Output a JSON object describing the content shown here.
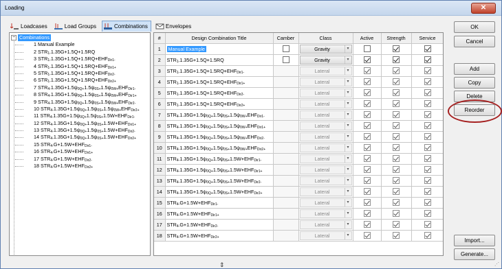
{
  "window": {
    "title": "Loading",
    "close_glyph": "✕"
  },
  "tabs": [
    {
      "label": "Loadcases",
      "icon": "loadcases-icon"
    },
    {
      "label": "Load Groups",
      "icon": "load-groups-icon"
    },
    {
      "label": "Combinations",
      "icon": "combinations-icon",
      "active": true
    },
    {
      "label": "Envelopes",
      "icon": "envelopes-icon"
    }
  ],
  "tree": {
    "root_label": "Combinations",
    "items": [
      "1 Manual Example",
      "2 STR_1-1.35G+1.5Q+1.5RQ",
      "3 STR_1-1.35G+1.5Q+1.5RQ+EHF_Dir1-",
      "4 STR_1-1.35G+1.5Q+1.5RQ+EHF_Dir1+",
      "5 STR_1-1.35G+1.5Q+1.5RQ+EHF_Dir2-",
      "6 STR_1-1.35G+1.5Q+1.5RQ+EHF_Dir2+",
      "7 STR_4-1.35G+1.5ψ_0Q+1.5ψ_0S+1.5ψ_0W+EHF_Dir1-",
      "8 STR_4-1.35G+1.5ψ_0Q+1.5ψ_0S+1.5ψ_0W+EHF_Dir1+",
      "9 STR_4-1.35G+1.5ψ_0Q+1.5ψ_0S+1.5ψ_0W+EHF_Dir2-",
      "10 STR_4-1.35G+1.5ψ_0Q+1.5ψ_0S+1.5ψ_0W+EHF_Dir2+",
      "11 STR_4-1.35G+1.5ψ_0Q+1.5ψ_0S+1.5W+EHF_Dir1-",
      "12 STR_4-1.35G+1.5ψ_0Q+1.5ψ_0S+1.5W+EHF_Dir1+",
      "13 STR_4-1.35G+1.5ψ_0Q+1.5ψ_0S+1.5W+EHF_Dir2-",
      "14 STR_4-1.35G+1.5ψ_0Q+1.5ψ_0S+1.5W+EHF_Dir2+",
      "15 STR_4-G+1.5W+EHF_Dir1-",
      "16 STR_4-G+1.5W+EHF_Dir1+",
      "17 STR_4-G+1.5W+EHF_Dir2-",
      "18 STR_4-G+1.5W+EHF_Dir2+"
    ]
  },
  "table": {
    "headers": [
      "#",
      "Design Combination Title",
      "Camber",
      "Class",
      "Active",
      "Strength",
      "Service"
    ],
    "rows": [
      {
        "n": "1",
        "title": "Manual Example",
        "camber": "unchecked",
        "cls": "Gravity",
        "cls_enabled": true,
        "active": false,
        "strength": true,
        "service": true,
        "selected": true
      },
      {
        "n": "2",
        "title": "STR_1-1.35G+1.5Q+1.5RQ",
        "camber": "unchecked",
        "cls": "Gravity",
        "cls_enabled": true,
        "active": true,
        "strength": true,
        "service": true
      },
      {
        "n": "3",
        "title": "STR_1-1.35G+1.5Q+1.5RQ+EHF_Dir1-",
        "camber": "",
        "cls": "Lateral",
        "cls_enabled": false,
        "active": true,
        "strength": true,
        "service": true
      },
      {
        "n": "4",
        "title": "STR_1-1.35G+1.5Q+1.5RQ+EHF_Dir1+",
        "camber": "",
        "cls": "Lateral",
        "cls_enabled": false,
        "active": true,
        "strength": true,
        "service": true
      },
      {
        "n": "5",
        "title": "STR_1-1.35G+1.5Q+1.5RQ+EHF_Dir2-",
        "camber": "",
        "cls": "Lateral",
        "cls_enabled": false,
        "active": true,
        "strength": true,
        "service": true
      },
      {
        "n": "6",
        "title": "STR_1-1.35G+1.5Q+1.5RQ+EHF_Dir2+",
        "camber": "",
        "cls": "Lateral",
        "cls_enabled": false,
        "active": true,
        "strength": true,
        "service": true
      },
      {
        "n": "7",
        "title": "STR_4-1.35G+1.5ψ_0Q+1.5ψ_0S+1.5ψ_0W+EHF_Dir1-",
        "camber": "",
        "cls": "Lateral",
        "cls_enabled": false,
        "active": true,
        "strength": true,
        "service": true
      },
      {
        "n": "8",
        "title": "STR_4-1.35G+1.5ψ_0Q+1.5ψ_0S+1.5ψ_0W+EHF_Dir1+",
        "camber": "",
        "cls": "Lateral",
        "cls_enabled": false,
        "active": true,
        "strength": true,
        "service": true
      },
      {
        "n": "9",
        "title": "STR_4-1.35G+1.5ψ_0Q+1.5ψ_0S+1.5ψ_0W+EHF_Dir2-",
        "camber": "",
        "cls": "Lateral",
        "cls_enabled": false,
        "active": true,
        "strength": true,
        "service": true
      },
      {
        "n": "10",
        "title": "STR_4-1.35G+1.5ψ_0Q+1.5ψ_0S+1.5ψ_0W+EHF_Dir2+",
        "camber": "",
        "cls": "Lateral",
        "cls_enabled": false,
        "active": true,
        "strength": true,
        "service": true
      },
      {
        "n": "11",
        "title": "STR_4-1.35G+1.5ψ_0Q+1.5ψ_0S+1.5W+EHF_Dir1-",
        "camber": "",
        "cls": "Lateral",
        "cls_enabled": false,
        "active": true,
        "strength": true,
        "service": true
      },
      {
        "n": "12",
        "title": "STR_4-1.35G+1.5ψ_0Q+1.5ψ_0S+1.5W+EHF_Dir1+",
        "camber": "",
        "cls": "Lateral",
        "cls_enabled": false,
        "active": true,
        "strength": true,
        "service": true
      },
      {
        "n": "13",
        "title": "STR_4-1.35G+1.5ψ_0Q+1.5ψ_0S+1.5W+EHF_Dir2-",
        "camber": "",
        "cls": "Lateral",
        "cls_enabled": false,
        "active": true,
        "strength": true,
        "service": true
      },
      {
        "n": "14",
        "title": "STR_4-1.35G+1.5ψ_0Q+1.5ψ_0S+1.5W+EHF_Dir2+",
        "camber": "",
        "cls": "Lateral",
        "cls_enabled": false,
        "active": true,
        "strength": true,
        "service": true
      },
      {
        "n": "15",
        "title": "STR_4-G+1.5W+EHF_Dir1-",
        "camber": "",
        "cls": "Lateral",
        "cls_enabled": false,
        "active": true,
        "strength": true,
        "service": true
      },
      {
        "n": "16",
        "title": "STR_4-G+1.5W+EHF_Dir1+",
        "camber": "",
        "cls": "Lateral",
        "cls_enabled": false,
        "active": true,
        "strength": true,
        "service": true
      },
      {
        "n": "17",
        "title": "STR_4-G+1.5W+EHF_Dir2-",
        "camber": "",
        "cls": "Lateral",
        "cls_enabled": false,
        "active": true,
        "strength": true,
        "service": true
      },
      {
        "n": "18",
        "title": "STR_4-G+1.5W+EHF_Dir2+",
        "camber": "",
        "cls": "Lateral",
        "cls_enabled": false,
        "active": true,
        "strength": true,
        "service": true
      }
    ]
  },
  "buttons": {
    "ok": "OK",
    "cancel": "Cancel",
    "add": "Add",
    "copy": "Copy",
    "delete": "Delete",
    "reorder": "Reorder",
    "import": "Import...",
    "generate": "Generate..."
  },
  "colors": {
    "selection": "#3399ff",
    "highlight_ellipse": "#a52020"
  }
}
